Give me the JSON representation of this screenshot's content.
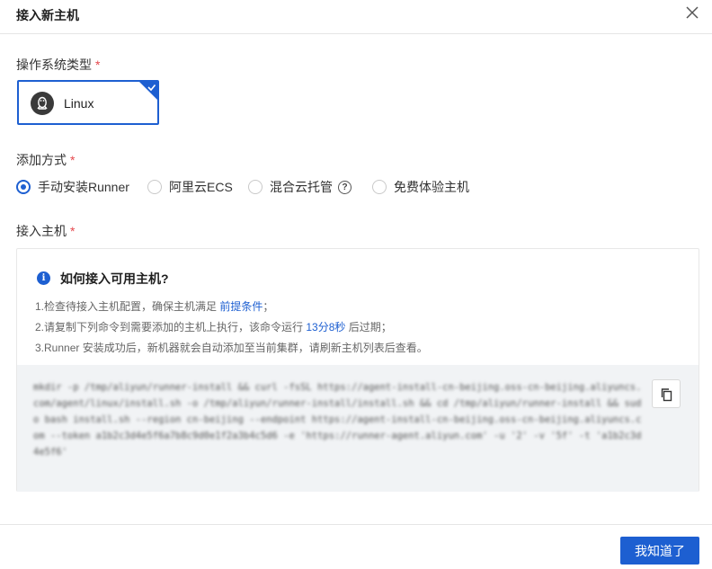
{
  "dialog": {
    "title": "接入新主机"
  },
  "os_section": {
    "label": "操作系统类型",
    "required_mark": "*",
    "selected_os": "Linux"
  },
  "method_section": {
    "label": "添加方式",
    "required_mark": "*",
    "options": [
      {
        "label": "手动安装Runner",
        "selected": true
      },
      {
        "label": "阿里云ECS",
        "selected": false
      },
      {
        "label": "混合云托管",
        "selected": false,
        "help": "?"
      },
      {
        "label": "免费体验主机",
        "selected": false
      }
    ]
  },
  "host_section": {
    "label": "接入主机",
    "required_mark": "*",
    "guide": {
      "info_glyph": "i",
      "title": "如何接入可用主机?",
      "step1_prefix": "1.检查待接入主机配置，确保主机满足",
      "step1_link": "前提条件",
      "step1_suffix": "；",
      "step2_prefix": "2.请复制下列命令到需要添加的主机上执行，该命令运行",
      "step2_time": "13分8秒",
      "step2_suffix": "后过期；",
      "step3": "3.Runner 安装成功后，新机器就会自动添加至当前集群，请刷新主机列表后查看。"
    },
    "command_blurred": "mkdir -p /tmp/aliyun/runner-install && curl -fsSL https://agent-install-cn-beijing.oss-cn-beijing.aliyuncs.com/agent/linux/install.sh -o /tmp/aliyun/runner-install/install.sh && cd /tmp/aliyun/runner-install && sudo bash install.sh --region cn-beijing --endpoint https://agent-install-cn-beijing.oss-cn-beijing.aliyuncs.com --token a1b2c3d4e5f6a7b8c9d0e1f2a3b4c5d6 -e 'https://runner-agent.aliyun.com' -u '2' -v '5f' -t 'a1b2c3d4e5f6'"
  },
  "footer": {
    "confirm_label": "我知道了"
  },
  "colors": {
    "primary": "#1d5fd1",
    "required": "#e5484d",
    "code_bg": "#f1f3f5"
  },
  "icons": [
    "close-icon",
    "linux-penguin-icon",
    "selected-check-icon",
    "help-icon",
    "info-icon",
    "copy-icon"
  ]
}
